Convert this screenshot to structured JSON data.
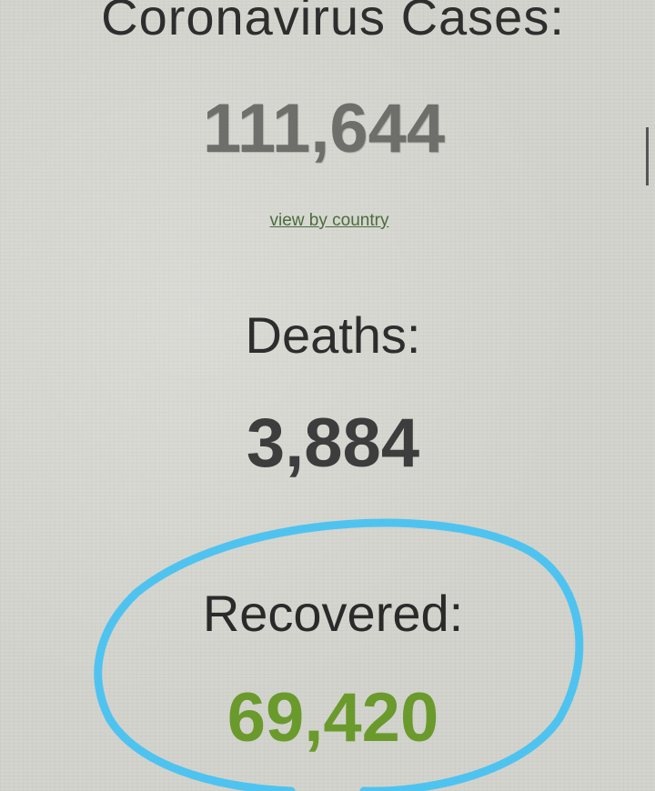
{
  "stats": {
    "cases_heading": "Coronavirus Cases:",
    "cases_count": "111,644",
    "view_by_country": "view by country",
    "deaths_heading": "Deaths:",
    "deaths_count": "3,884",
    "recovered_heading": "Recovered:",
    "recovered_count": "69,420"
  },
  "colors": {
    "background": "#d3d4cd",
    "recovered_green": "#6a9a2c",
    "highlight_circle": "#4fc3f0"
  }
}
